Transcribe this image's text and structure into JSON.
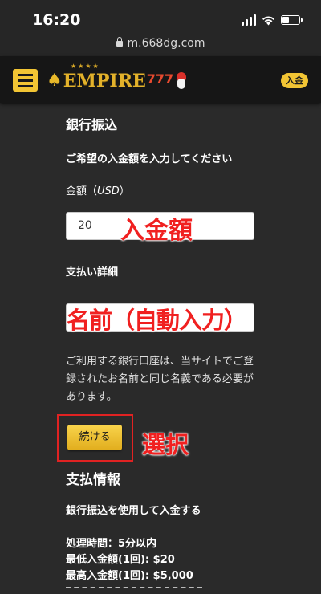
{
  "status_bar": {
    "time": "16:20",
    "url": "m.668dg.com"
  },
  "header": {
    "logo_word": "EMPIRE",
    "logo_num": "777",
    "logo_stars": "★★★★",
    "deposit_label": "入金"
  },
  "form": {
    "heading": "銀行振込",
    "prompt": "ご希望の入金額を入力してください",
    "amount_label": "金額（",
    "amount_unit": "USD",
    "amount_label_end": "）",
    "amount_value": "20",
    "amount_annotation": "入金額",
    "details_label": "支払い詳細",
    "name_annotation": "名前（自動入力）",
    "note": "ご利用する銀行口座は、当サイトでご登録されたお名前と同じ名義である必要があります。",
    "continue_label": "続ける",
    "select_annotation": "選択"
  },
  "payment_info": {
    "heading": "支払情報",
    "method": "銀行振込を使用して入金する",
    "processing_time": "処理時間：5分以内",
    "min_deposit": "最低入金額(1回): $20",
    "max_deposit": "最高入金額(1回): $5,000"
  },
  "colors": {
    "accent": "#f2c534",
    "annotation": "#f02020",
    "background": "#2a2a2a"
  }
}
